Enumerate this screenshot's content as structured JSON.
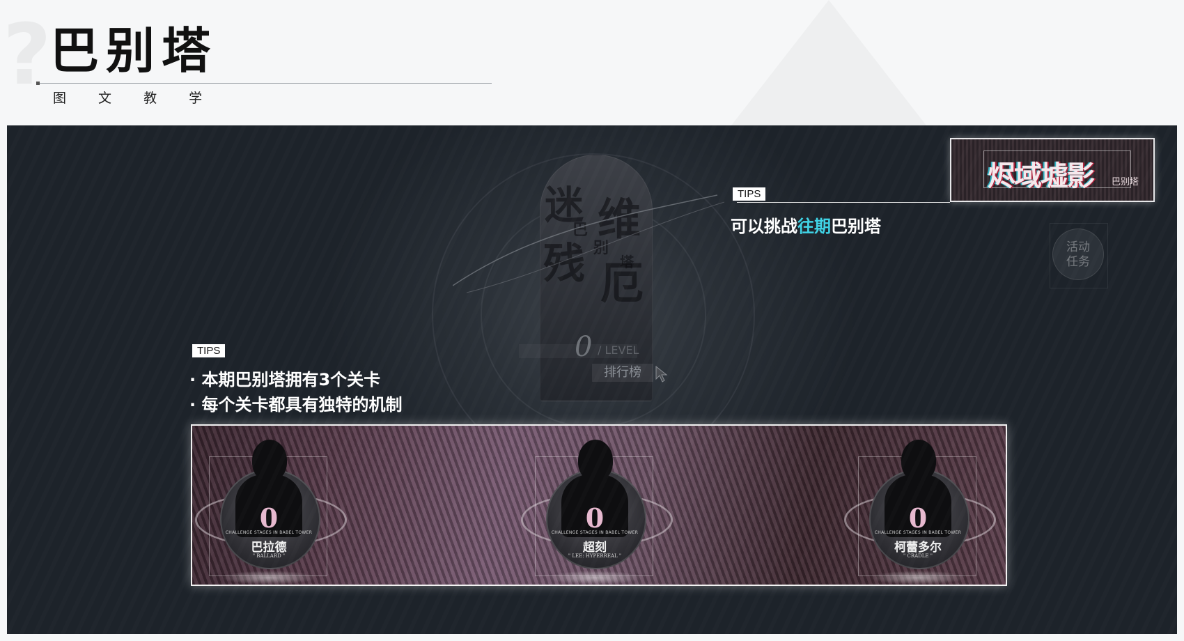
{
  "header": {
    "title": "巴别塔",
    "subtitle": "图 文 教 学"
  },
  "tower": {
    "level_value": "0",
    "level_unit": "/ LEVEL",
    "rank_label": "排行榜",
    "glyphs": [
      "迷",
      "巴",
      "别",
      "塔",
      "残",
      "维",
      "厄"
    ]
  },
  "tips_top": {
    "tag": "TIPS",
    "text_before": "可以挑战",
    "text_highlight": "往期",
    "text_after": "巴别塔"
  },
  "tips_left": {
    "tag": "TIPS",
    "lines": [
      "· 本期巴别塔拥有3个关卡",
      "· 每个关卡都具有独特的机制"
    ]
  },
  "event_banner": {
    "title": "烬域墟影",
    "subtitle": "巴别塔"
  },
  "side_button": {
    "label_line1": "活动",
    "label_line2": "任务"
  },
  "stages": [
    {
      "value": "0",
      "caption": "CHALLENGE STAGES IN BABEL TOWER",
      "name": "巴拉德",
      "english": "\" BALLARD \""
    },
    {
      "value": "0",
      "caption": "CHALLENGE STAGES IN BABEL TOWER",
      "name": "超刻",
      "english": "\" LEE: HYPERREAL \""
    },
    {
      "value": "0",
      "caption": "CHALLENGE STAGES IN BABEL TOWER",
      "name": "柯蕾多尔",
      "english": "\" CRADLE \""
    }
  ],
  "colors": {
    "highlight": "#3fd3e6",
    "stage_value": "#e7b9cf"
  }
}
